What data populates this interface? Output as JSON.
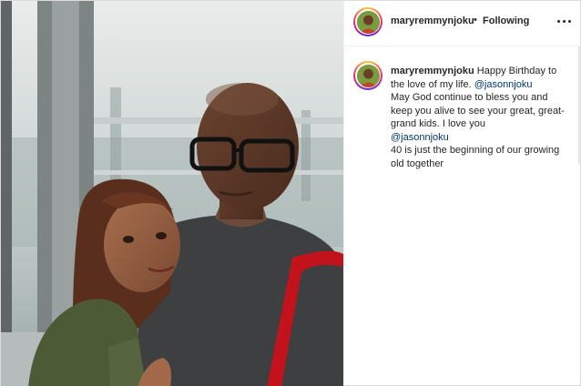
{
  "post": {
    "author": "maryremmynjoku",
    "follow_dot": "•",
    "follow_status": "Following",
    "more_icon": "more-horizontal-icon",
    "caption": {
      "username": "maryremmynjoku",
      "text_start": "Happy Birthday to the love of my life.",
      "mention_1": "@jasonnjoku",
      "text_middle": "May God continue to bless you and keep you alive to see your great, great-grand kids. I love you",
      "mention_2": "@jasonnjoku",
      "text_end": "40 is just the beginning of our growing old together"
    }
  },
  "colors": {
    "mention": "#00376b",
    "text": "#262626",
    "border": "#dbdbdb"
  }
}
